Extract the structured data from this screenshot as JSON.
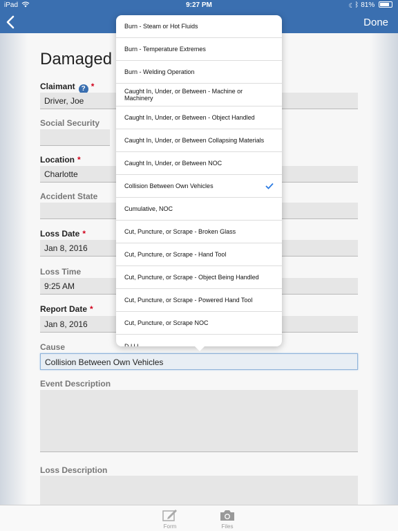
{
  "status_bar": {
    "device": "iPad",
    "time": "9:27 PM",
    "battery": "81%",
    "battery_level": 0.81
  },
  "nav": {
    "done_label": "Done"
  },
  "form": {
    "title": "Damaged C",
    "claimant": {
      "label": "Claimant",
      "value": "Driver, Joe"
    },
    "social_security": {
      "label": "Social Security",
      "value": ""
    },
    "location": {
      "label": "Location",
      "value": "Charlotte"
    },
    "accident_state": {
      "label": "Accident State",
      "value": ""
    },
    "loss_date": {
      "label": "Loss Date",
      "value": "Jan 8, 2016"
    },
    "loss_time": {
      "label": "Loss Time",
      "value": "9:25 AM"
    },
    "report_date": {
      "label": "Report Date",
      "value": "Jan 8, 2016"
    },
    "cause": {
      "label": "Cause",
      "value": "Collision Between Own Vehicles"
    },
    "event_description": {
      "label": "Event Description",
      "value": ""
    },
    "loss_description": {
      "label": "Loss Description",
      "value": ""
    }
  },
  "cause_options": [
    "Burn - Steam or Hot Fluids",
    "Burn - Temperature Extremes",
    "Burn - Welding Operation",
    "Caught In, Under, or Between - Machine or Machinery",
    "Caught In, Under, or Between - Object Handled",
    "Caught In, Under, or Between Collapsing Materials",
    "Caught In, Under, or Between NOC",
    "Collision Between Own Vehicles",
    "Cumulative, NOC",
    "Cut, Puncture, or Scrape - Broken Glass",
    "Cut, Puncture, or Scrape - Hand Tool",
    "Cut, Puncture, or Scrape - Object Being Handled",
    "Cut, Puncture, or Scrape - Powered Hand Tool",
    "Cut, Puncture, or Scrape NOC",
    "D.U.I."
  ],
  "selected_cause_index": 7,
  "tabs": [
    {
      "label": "Form",
      "icon": "pencil-icon"
    },
    {
      "label": "Files",
      "icon": "camera-icon"
    }
  ],
  "colors": {
    "nav_bar": "#3a6fb0",
    "required": "#d0021b",
    "checkmark": "#2a7ae2"
  }
}
